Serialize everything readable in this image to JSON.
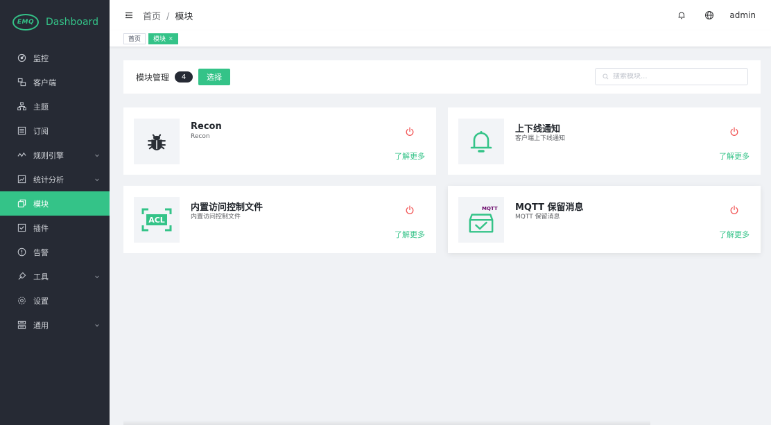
{
  "logo": {
    "badge": "EMQ",
    "text": "Dashboard"
  },
  "sidebar": {
    "items": [
      {
        "label": "监控",
        "icon": "monitor-icon",
        "arrow": false,
        "active": false
      },
      {
        "label": "客户端",
        "icon": "clients-icon",
        "arrow": false,
        "active": false
      },
      {
        "label": "主题",
        "icon": "topics-icon",
        "arrow": false,
        "active": false
      },
      {
        "label": "订阅",
        "icon": "subscriptions-icon",
        "arrow": false,
        "active": false
      },
      {
        "label": "规则引擎",
        "icon": "rule-engine-icon",
        "arrow": true,
        "active": false
      },
      {
        "label": "统计分析",
        "icon": "analysis-icon",
        "arrow": true,
        "active": false
      },
      {
        "label": "模块",
        "icon": "modules-icon",
        "arrow": false,
        "active": true
      },
      {
        "label": "插件",
        "icon": "plugins-icon",
        "arrow": false,
        "active": false
      },
      {
        "label": "告警",
        "icon": "alarm-icon",
        "arrow": false,
        "active": false
      },
      {
        "label": "工具",
        "icon": "tools-icon",
        "arrow": true,
        "active": false
      },
      {
        "label": "设置",
        "icon": "settings-icon",
        "arrow": false,
        "active": false
      },
      {
        "label": "通用",
        "icon": "general-icon",
        "arrow": true,
        "active": false
      }
    ]
  },
  "header": {
    "breadcrumb_home": "首页",
    "breadcrumb_sep": "/",
    "breadcrumb_current": "模块",
    "user": "admin"
  },
  "tags": {
    "home": "首页",
    "current": "模块",
    "close": "×"
  },
  "toolbar": {
    "title": "模块管理",
    "count": "4",
    "select_label": "选择",
    "search_placeholder": "搜索模块..."
  },
  "modules": [
    {
      "name": "Recon",
      "desc": "Recon",
      "icon": "bug-icon",
      "more": "了解更多"
    },
    {
      "name": "上下线通知",
      "desc": "客户端上下线通知",
      "icon": "bell-icon",
      "more": "了解更多"
    },
    {
      "name": "内置访问控制文件",
      "desc": "内置访问控制文件",
      "icon": "acl-icon",
      "icon_text": "ACL",
      "more": "了解更多"
    },
    {
      "name": "MQTT 保留消息",
      "desc": "MQTT 保留消息",
      "icon": "retained-message-icon",
      "brand": "MQTT",
      "more": "了解更多"
    }
  ],
  "colors": {
    "sidebar_bg": "#262a34",
    "accent": "#34c388",
    "power": "#f25656",
    "content_bg": "#f0f2f5"
  }
}
